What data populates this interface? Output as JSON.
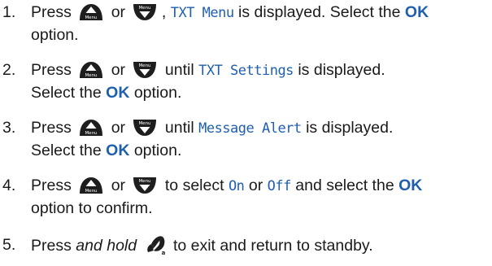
{
  "steps": [
    {
      "number": "1.",
      "t1": "Press",
      "t2": "or",
      "t3": ",",
      "lcd": "TXT Menu",
      "t4": "is displayed. Select the",
      "ok": "OK",
      "t5": "option."
    },
    {
      "number": "2.",
      "t1": "Press",
      "t2": "or",
      "t3": "until",
      "lcd": "TXT Settings",
      "t4": "is displayed.",
      "t5": "Select the",
      "ok": "OK",
      "t6": "option."
    },
    {
      "number": "3.",
      "t1": "Press",
      "t2": "or",
      "t3": "until",
      "lcd": "Message Alert",
      "t4": "is displayed.",
      "t5": "Select the",
      "ok": "OK",
      "t6": "option."
    },
    {
      "number": "4.",
      "t1": "Press",
      "t2": "or",
      "t3": "to select",
      "lcd_on": "On",
      "t4": "or",
      "lcd_off": "Off",
      "t5": "and select the",
      "ok": "OK",
      "t6": "option to confirm."
    },
    {
      "number": "5.",
      "t1": "Press",
      "em": "and hold",
      "t2": "to exit and return to standby."
    }
  ],
  "icons": {
    "up_key": "up-key-menu-icon",
    "down_key": "down-key-menu-icon",
    "end_key": "end-call-icon",
    "key_label": "Menu",
    "end_sub": "a"
  },
  "colors": {
    "accent": "#1f5fae",
    "key": "#1e1e1e",
    "text": "#1a1a1a"
  }
}
